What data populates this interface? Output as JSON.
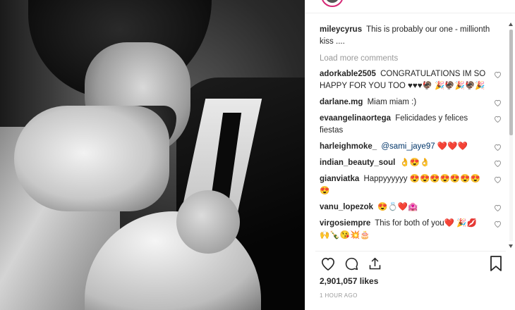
{
  "post": {
    "caption_user": "mileycyrus",
    "caption_text": "This is probably our one - millionth kiss ....",
    "load_more": "Load more comments"
  },
  "comments": [
    {
      "user": "adorkable2505",
      "text": "CONGRATULATIONS IM SO HAPPY FOR YOU TOO ♥♥♥🦃 🎉🦃🎉🦃🎉"
    },
    {
      "user": "darlane.mg",
      "text": "Miam miam :)"
    },
    {
      "user": "evaangelinaortega",
      "text": "Felicidades y felices fiestas"
    },
    {
      "user": "harleighmoke_",
      "mention": "@sami_jaye97",
      "text": "❤️❤️❤️"
    },
    {
      "user": "indian_beauty_soul",
      "text": "👌😍👌"
    },
    {
      "user": "gianviatka",
      "text": "Happyyyyyy 😍😍😍😍😍😍😍😍"
    },
    {
      "user": "vanu_lopezok",
      "text": "😍💍❤️🏩"
    },
    {
      "user": "virgosiempre",
      "text": "This for both of you❤️ 🎉💋🙌🍾😘💥🎂"
    }
  ],
  "footer": {
    "likes": "2,901,057 likes",
    "time": "1 HOUR AGO"
  },
  "icons": {
    "like": "heart-icon",
    "comment": "comment-icon",
    "share": "share-icon",
    "save": "bookmark-icon"
  }
}
